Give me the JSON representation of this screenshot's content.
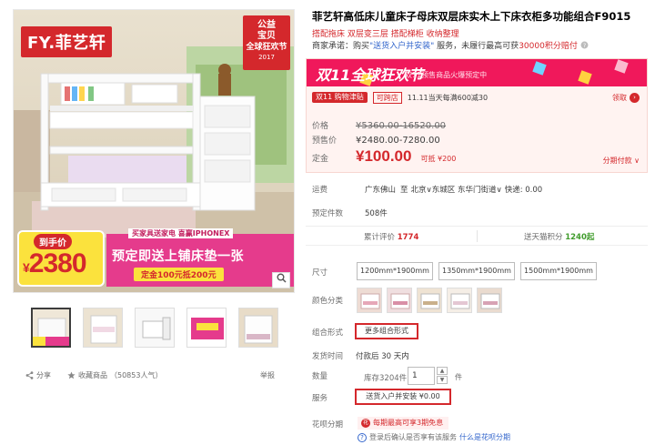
{
  "gallery": {
    "logo_prefix": "FY.",
    "logo_name": "菲艺轩",
    "festival_badge": {
      "line1": "公益",
      "line2": "宝贝",
      "line3": "全球狂欢节",
      "year": "2017"
    },
    "price_tag": {
      "label": "到手价",
      "currency": "¥",
      "value": "2380"
    },
    "promo": {
      "top": "买家具送家电 喜赢IPHONEX",
      "main": "预定即送上铺床垫一张",
      "coupon": "定金100元抵200元"
    },
    "zoom_icon": "magnifier-icon",
    "thumbnails_count": 5,
    "actions": {
      "share": "分享",
      "favorite": "收藏商品",
      "favorite_count": "（50853人气）",
      "report": "举报"
    }
  },
  "product": {
    "title": "菲艺轩高低床儿童床子母床双层床实木上下床衣柜多功能组合F9015",
    "subtitle": "搭配拖床 双层变三层 搭配梯柜 收纳整理",
    "promise_prefix": "商家承诺：购买",
    "promise_service": "\"送货入户并安装\"",
    "promise_middle": "服务，未履行最高可获",
    "promise_points": "30000积分赔付",
    "promise_icon": "question-icon"
  },
  "promo_box": {
    "banner_title": "双11全球狂欢节",
    "banner_sub": "双11预售商品火爆预定中",
    "tag_shopping": "双11 购物津贴",
    "tag_cross": "可跨店",
    "tag_text": "11.11当天每满600减30",
    "claim": "领取",
    "rows": {
      "price_label": "价格",
      "price_value": "¥5360.00-16520.00",
      "presale_label": "预售价",
      "presale_value": "¥2480.00-7280.00",
      "deposit_label": "定金",
      "deposit_value": "¥100.00",
      "deposit_note": "可抵 ¥200"
    },
    "installment": "分期付款"
  },
  "shipping": {
    "label": "运费",
    "from": "广东佛山",
    "to_word": "至",
    "to": "北京∨东城区 东华门街道∨",
    "fee": "快递: 0.00"
  },
  "presale_count": {
    "label": "预定件数",
    "value": "508件"
  },
  "stats": {
    "reviews_label": "累计评价",
    "reviews_value": "1774",
    "points_label": "送天猫积分",
    "points_value": "1240起"
  },
  "options": {
    "size_label": "尺寸",
    "sizes": [
      "1200mm*1900mm",
      "1350mm*1900mm",
      "1500mm*1900mm"
    ],
    "color_label": "颜色分类",
    "color_count": 5,
    "combo_label": "组合形式",
    "combo_value": "更多组合形式",
    "ship_time_label": "发货时间",
    "ship_time_value": "付款后 30 天内",
    "qty_label": "数量",
    "stock": "库存3204件",
    "qty_value": "1",
    "qty_unit": "件",
    "service_label": "服务",
    "service_value": "送货入户并安装 ¥0.00",
    "huabei_label": "花呗分期",
    "huabei_badge": "每期最高可享3期免息",
    "huabei_note": "登录后确认是否享有该服务",
    "huabei_link": "什么是花呗分期"
  },
  "colors": {
    "accent": "#d4282c",
    "festival": "#f0185b",
    "link": "#3366cc"
  }
}
